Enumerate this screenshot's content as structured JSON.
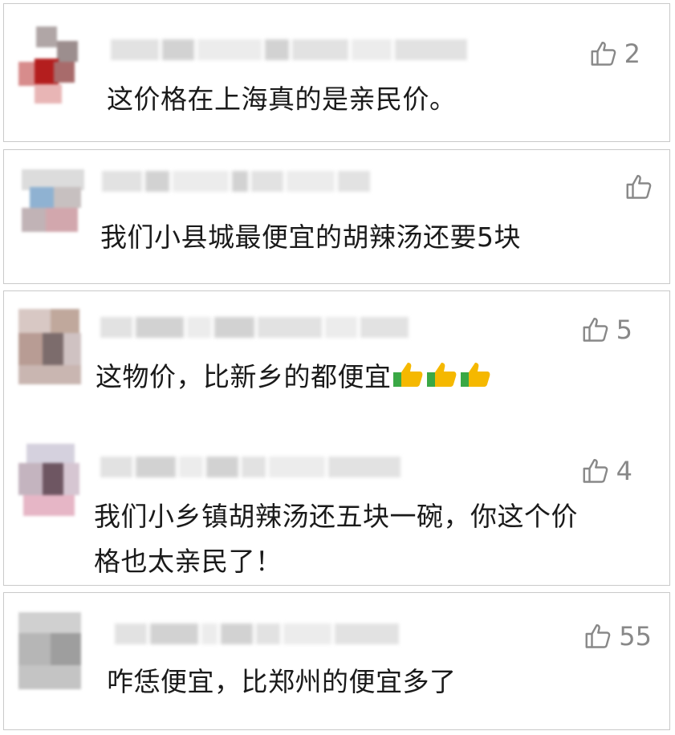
{
  "comments": [
    {
      "text": "这价格在上海真的是亲民价。",
      "likes": "2"
    },
    {
      "text": "我们小县城最便宜的胡辣汤还要5块",
      "likes": ""
    },
    {
      "text": "这物价，比新乡的都便宜",
      "likes": "5",
      "emoji": "thumbs-up-icon"
    },
    {
      "text_line1": "我们小乡镇胡辣汤还五块一碗，你这个价",
      "text_line2": "格也太亲民了！",
      "likes": "4"
    },
    {
      "text": "咋恁便宜，比郑州的便宜多了",
      "likes": "55"
    }
  ],
  "icons": {
    "like": "thumbs-up-outline-icon"
  },
  "colors": {
    "like_gray": "#888888",
    "border": "#c9c9c9",
    "emoji_yellow": "#f5b800",
    "emoji_green": "#3aa845"
  }
}
